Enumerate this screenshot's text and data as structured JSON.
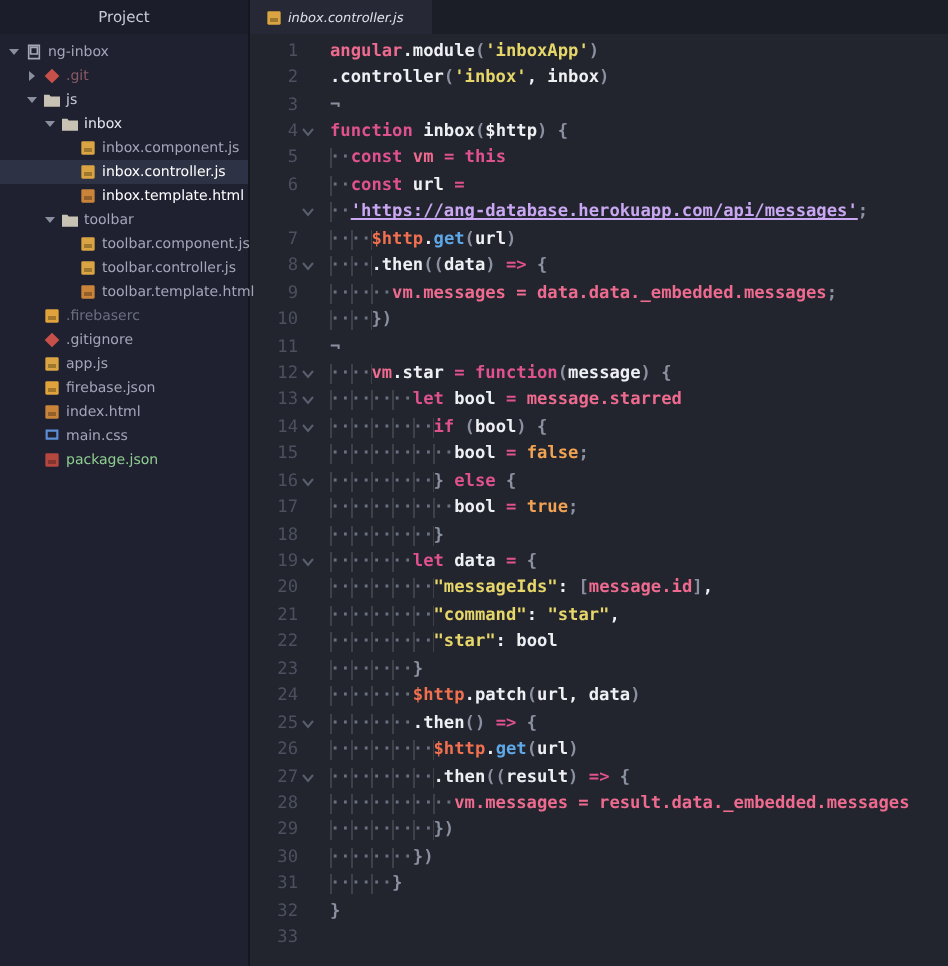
{
  "sidebar": {
    "title": "Project",
    "tree": [
      {
        "label": "ng-inbox",
        "kind": "project",
        "expanded": true,
        "selected": false,
        "color": "#a3a7b8",
        "children": [
          {
            "label": ".git",
            "kind": "git",
            "expanded": false,
            "selected": false,
            "color": "#8a5a66"
          },
          {
            "label": "js",
            "kind": "folder",
            "expanded": true,
            "selected": false,
            "color": "#c9ccd8",
            "children": [
              {
                "label": "inbox",
                "kind": "folder",
                "expanded": true,
                "selected": false,
                "color": "#e6e8ef",
                "children": [
                  {
                    "label": "inbox.component.js",
                    "kind": "js",
                    "selected": false,
                    "color": "#a3a7b8"
                  },
                  {
                    "label": "inbox.controller.js",
                    "kind": "js",
                    "selected": true,
                    "color": "#ffffff"
                  },
                  {
                    "label": "inbox.template.html",
                    "kind": "html",
                    "selected": false,
                    "color": "#ffffff"
                  }
                ]
              },
              {
                "label": "toolbar",
                "kind": "folder",
                "expanded": true,
                "selected": false,
                "color": "#a3a7b8",
                "children": [
                  {
                    "label": "toolbar.component.js",
                    "kind": "js",
                    "selected": false,
                    "color": "#a3a7b8"
                  },
                  {
                    "label": "toolbar.controller.js",
                    "kind": "js",
                    "selected": false,
                    "color": "#a3a7b8"
                  },
                  {
                    "label": "toolbar.template.html",
                    "kind": "html",
                    "selected": false,
                    "color": "#a3a7b8"
                  }
                ]
              }
            ]
          },
          {
            "label": ".firebaserc",
            "kind": "config",
            "selected": false,
            "color": "#6b6f80"
          },
          {
            "label": ".gitignore",
            "kind": "git",
            "selected": false,
            "color": "#a3a7b8"
          },
          {
            "label": "app.js",
            "kind": "js",
            "selected": false,
            "color": "#a3a7b8"
          },
          {
            "label": "firebase.json",
            "kind": "config",
            "selected": false,
            "color": "#a3a7b8"
          },
          {
            "label": "index.html",
            "kind": "html",
            "selected": false,
            "color": "#a3a7b8"
          },
          {
            "label": "main.css",
            "kind": "css",
            "selected": false,
            "color": "#a3a7b8"
          },
          {
            "label": "package.json",
            "kind": "package",
            "selected": false,
            "color": "#8fcf8f"
          }
        ]
      }
    ]
  },
  "tabs": [
    {
      "label": "inbox.controller.js",
      "kind": "js",
      "selected": true
    }
  ],
  "editor": {
    "lines": [
      {
        "number": "1",
        "tokens": [
          {
            "kind": "var",
            "text": "angular"
          },
          {
            "kind": "plain",
            "text": ".module"
          },
          {
            "kind": "dim",
            "text": "("
          },
          {
            "kind": "string",
            "text": "'inboxApp'"
          },
          {
            "kind": "dim",
            "text": ")"
          }
        ]
      },
      {
        "number": "2",
        "tokens": [
          {
            "kind": "plain",
            "text": ".controller"
          },
          {
            "kind": "dim",
            "text": "("
          },
          {
            "kind": "string",
            "text": "'inbox'"
          },
          {
            "kind": "plain",
            "text": ", inbox"
          },
          {
            "kind": "dim",
            "text": ")"
          }
        ]
      },
      {
        "number": "3",
        "tokens": [
          {
            "kind": "dim",
            "text": "¬"
          }
        ]
      },
      {
        "number": "4",
        "fold": true,
        "tokens": [
          {
            "kind": "keyword",
            "text": "function"
          },
          {
            "kind": "plain",
            "text": " inbox"
          },
          {
            "kind": "dim",
            "text": "("
          },
          {
            "kind": "plain",
            "text": "$http"
          },
          {
            "kind": "dim",
            "text": ") {"
          }
        ]
      },
      {
        "number": "5",
        "tokens": [
          {
            "kind": "ws",
            "text": "··"
          },
          {
            "kind": "keyword",
            "text": "const"
          },
          {
            "kind": "var",
            "text": " vm"
          },
          {
            "kind": "keyword",
            "text": " = "
          },
          {
            "kind": "keyword",
            "text": "this"
          }
        ]
      },
      {
        "number": "6",
        "tokens": [
          {
            "kind": "ws",
            "text": "··"
          },
          {
            "kind": "keyword",
            "text": "const"
          },
          {
            "kind": "plain",
            "text": " url "
          },
          {
            "kind": "keyword",
            "text": "="
          }
        ]
      },
      {
        "fold": true,
        "tokens": [
          {
            "kind": "ws",
            "text": "··"
          },
          {
            "kind": "url",
            "text": "'https://ang-database.herokuapp.com/api/messages'"
          },
          {
            "kind": "dim",
            "text": ";"
          }
        ]
      },
      {
        "number": "7",
        "tokens": [
          {
            "kind": "ws",
            "text": "····"
          },
          {
            "kind": "http",
            "text": "$http"
          },
          {
            "kind": "plain",
            "text": "."
          },
          {
            "kind": "func",
            "text": "get"
          },
          {
            "kind": "dim",
            "text": "("
          },
          {
            "kind": "plain",
            "text": "url"
          },
          {
            "kind": "dim",
            "text": ")"
          }
        ]
      },
      {
        "number": "8",
        "fold": true,
        "tokens": [
          {
            "kind": "ws",
            "text": "····"
          },
          {
            "kind": "plain",
            "text": ".then"
          },
          {
            "kind": "dim",
            "text": "(("
          },
          {
            "kind": "plain",
            "text": "data"
          },
          {
            "kind": "dim",
            "text": ")"
          },
          {
            "kind": "keyword",
            "text": " => "
          },
          {
            "kind": "dim",
            "text": "{"
          }
        ]
      },
      {
        "number": "9",
        "tokens": [
          {
            "kind": "ws",
            "text": "······"
          },
          {
            "kind": "var",
            "text": "vm.messages = data.data._embedded.messages"
          },
          {
            "kind": "dim",
            "text": ";"
          }
        ]
      },
      {
        "number": "10",
        "tokens": [
          {
            "kind": "ws",
            "text": "····"
          },
          {
            "kind": "dim",
            "text": "})"
          }
        ]
      },
      {
        "number": "11",
        "tokens": [
          {
            "kind": "dim",
            "text": "¬"
          }
        ]
      },
      {
        "number": "12",
        "fold": true,
        "tokens": [
          {
            "kind": "ws",
            "text": "····"
          },
          {
            "kind": "var",
            "text": "vm"
          },
          {
            "kind": "plain",
            "text": ".star "
          },
          {
            "kind": "keyword",
            "text": "= function"
          },
          {
            "kind": "dim",
            "text": "("
          },
          {
            "kind": "plain",
            "text": "message"
          },
          {
            "kind": "dim",
            "text": ") {"
          }
        ]
      },
      {
        "number": "13",
        "fold": true,
        "tokens": [
          {
            "kind": "ws",
            "text": "········"
          },
          {
            "kind": "keyword",
            "text": "let"
          },
          {
            "kind": "plain",
            "text": " bool "
          },
          {
            "kind": "keyword",
            "text": "="
          },
          {
            "kind": "var",
            "text": " message.starred"
          }
        ]
      },
      {
        "number": "14",
        "fold": true,
        "tokens": [
          {
            "kind": "ws",
            "text": "··········"
          },
          {
            "kind": "keyword",
            "text": "if"
          },
          {
            "kind": "dim",
            "text": " ("
          },
          {
            "kind": "plain",
            "text": "bool"
          },
          {
            "kind": "dim",
            "text": ") {"
          }
        ]
      },
      {
        "number": "15",
        "tokens": [
          {
            "kind": "ws",
            "text": "············"
          },
          {
            "kind": "plain",
            "text": "bool "
          },
          {
            "kind": "keyword",
            "text": "= "
          },
          {
            "kind": "bool",
            "text": "false"
          },
          {
            "kind": "dim",
            "text": ";"
          }
        ]
      },
      {
        "number": "16",
        "fold": true,
        "tokens": [
          {
            "kind": "ws",
            "text": "··········"
          },
          {
            "kind": "dim",
            "text": "} "
          },
          {
            "kind": "keyword",
            "text": "else"
          },
          {
            "kind": "dim",
            "text": " {"
          }
        ]
      },
      {
        "number": "17",
        "tokens": [
          {
            "kind": "ws",
            "text": "············"
          },
          {
            "kind": "plain",
            "text": "bool "
          },
          {
            "kind": "keyword",
            "text": "= "
          },
          {
            "kind": "bool",
            "text": "true"
          },
          {
            "kind": "dim",
            "text": ";"
          }
        ]
      },
      {
        "number": "18",
        "tokens": [
          {
            "kind": "ws",
            "text": "··········"
          },
          {
            "kind": "dim",
            "text": "}"
          }
        ]
      },
      {
        "number": "19",
        "fold": true,
        "tokens": [
          {
            "kind": "ws",
            "text": "········"
          },
          {
            "kind": "keyword",
            "text": "let"
          },
          {
            "kind": "plain",
            "text": " data "
          },
          {
            "kind": "keyword",
            "text": "="
          },
          {
            "kind": "dim",
            "text": " {"
          }
        ]
      },
      {
        "number": "20",
        "tokens": [
          {
            "kind": "ws",
            "text": "··········"
          },
          {
            "kind": "string",
            "text": "\"messageIds\""
          },
          {
            "kind": "plain",
            "text": ": "
          },
          {
            "kind": "dim",
            "text": "["
          },
          {
            "kind": "var",
            "text": "message.id"
          },
          {
            "kind": "dim",
            "text": "]"
          },
          {
            "kind": "plain",
            "text": ","
          }
        ]
      },
      {
        "number": "21",
        "tokens": [
          {
            "kind": "ws",
            "text": "··········"
          },
          {
            "kind": "string",
            "text": "\"command\""
          },
          {
            "kind": "plain",
            "text": ": "
          },
          {
            "kind": "string",
            "text": "\"star\""
          },
          {
            "kind": "plain",
            "text": ","
          }
        ]
      },
      {
        "number": "22",
        "tokens": [
          {
            "kind": "ws",
            "text": "··········"
          },
          {
            "kind": "string",
            "text": "\"star\""
          },
          {
            "kind": "plain",
            "text": ": bool"
          }
        ]
      },
      {
        "number": "23",
        "tokens": [
          {
            "kind": "ws",
            "text": "········"
          },
          {
            "kind": "dim",
            "text": "}"
          }
        ]
      },
      {
        "number": "24",
        "tokens": [
          {
            "kind": "ws",
            "text": "········"
          },
          {
            "kind": "http",
            "text": "$http"
          },
          {
            "kind": "plain",
            "text": ".patch"
          },
          {
            "kind": "dim",
            "text": "("
          },
          {
            "kind": "plain",
            "text": "url, data"
          },
          {
            "kind": "dim",
            "text": ")"
          }
        ]
      },
      {
        "number": "25",
        "fold": true,
        "tokens": [
          {
            "kind": "ws",
            "text": "········"
          },
          {
            "kind": "plain",
            "text": ".then"
          },
          {
            "kind": "dim",
            "text": "()"
          },
          {
            "kind": "keyword",
            "text": " => "
          },
          {
            "kind": "dim",
            "text": "{"
          }
        ]
      },
      {
        "number": "26",
        "tokens": [
          {
            "kind": "ws",
            "text": "··········"
          },
          {
            "kind": "http",
            "text": "$http"
          },
          {
            "kind": "plain",
            "text": "."
          },
          {
            "kind": "func",
            "text": "get"
          },
          {
            "kind": "dim",
            "text": "("
          },
          {
            "kind": "plain",
            "text": "url"
          },
          {
            "kind": "dim",
            "text": ")"
          }
        ]
      },
      {
        "number": "27",
        "fold": true,
        "tokens": [
          {
            "kind": "ws",
            "text": "··········"
          },
          {
            "kind": "plain",
            "text": ".then"
          },
          {
            "kind": "dim",
            "text": "(("
          },
          {
            "kind": "plain",
            "text": "result"
          },
          {
            "kind": "dim",
            "text": ")"
          },
          {
            "kind": "keyword",
            "text": " => "
          },
          {
            "kind": "dim",
            "text": "{"
          }
        ]
      },
      {
        "number": "28",
        "tokens": [
          {
            "kind": "ws",
            "text": "············"
          },
          {
            "kind": "var",
            "text": "vm.messages = result.data._embedded.messages"
          }
        ]
      },
      {
        "number": "29",
        "tokens": [
          {
            "kind": "ws",
            "text": "··········"
          },
          {
            "kind": "dim",
            "text": "})"
          }
        ]
      },
      {
        "number": "30",
        "tokens": [
          {
            "kind": "ws",
            "text": "········"
          },
          {
            "kind": "dim",
            "text": "})"
          }
        ]
      },
      {
        "number": "31",
        "tokens": [
          {
            "kind": "ws",
            "text": "······"
          },
          {
            "kind": "dim",
            "text": "}"
          }
        ]
      },
      {
        "number": "32",
        "tokens": [
          {
            "kind": "dim",
            "text": "}"
          }
        ]
      },
      {
        "number": "33"
      }
    ]
  }
}
